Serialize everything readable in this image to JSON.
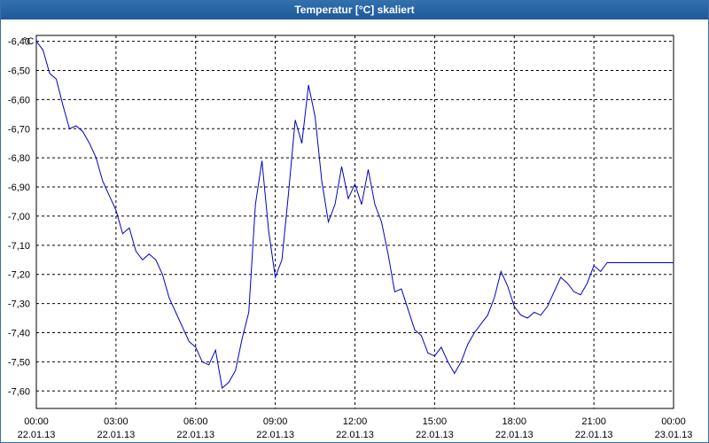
{
  "window": {
    "title": "Temperatur [°C] skaliert"
  },
  "colors": {
    "titlebar": "#1f5a99",
    "line": "#0000c8",
    "grid": "#000000",
    "background": "#ffffff"
  },
  "chart_data": {
    "type": "line",
    "title": "Temperatur [°C] skaliert",
    "ylabel": "°C",
    "xlabel": "",
    "grid": true,
    "ylim": [
      -7.66,
      -6.38
    ],
    "xlim": [
      0,
      24
    ],
    "y_ticks": [
      "-6,40",
      "-6,50",
      "-6,60",
      "-6,70",
      "-6,80",
      "-6,90",
      "-7,00",
      "-7,10",
      "-7,20",
      "-7,30",
      "-7,40",
      "-7,50",
      "-7,60"
    ],
    "x_ticks": [
      {
        "time": "00:00",
        "date": "22.01.13"
      },
      {
        "time": "03:00",
        "date": "22.01.13"
      },
      {
        "time": "06:00",
        "date": "22.01.13"
      },
      {
        "time": "09:00",
        "date": "22.01.13"
      },
      {
        "time": "12:00",
        "date": "22.01.13"
      },
      {
        "time": "15:00",
        "date": "22.01.13"
      },
      {
        "time": "18:00",
        "date": "22.01.13"
      },
      {
        "time": "21:00",
        "date": "22.01.13"
      },
      {
        "time": "00:00",
        "date": "23.01.13"
      }
    ],
    "series": [
      {
        "x": [
          0.0,
          0.25,
          0.5,
          0.75,
          1.0,
          1.25,
          1.5,
          1.75,
          2.0,
          2.25,
          2.5,
          2.75,
          3.0,
          3.25,
          3.5,
          3.75,
          4.0,
          4.25,
          4.5,
          4.75,
          5.0,
          5.25,
          5.5,
          5.75,
          6.0,
          6.25,
          6.5,
          6.75,
          7.0,
          7.25,
          7.5,
          7.75,
          8.0,
          8.25,
          8.5,
          8.75,
          9.0,
          9.25,
          9.5,
          9.75,
          10.0,
          10.25,
          10.5,
          10.75,
          11.0,
          11.25,
          11.5,
          11.75,
          12.0,
          12.25,
          12.5,
          12.75,
          13.0,
          13.25,
          13.5,
          13.75,
          14.0,
          14.25,
          14.5,
          14.75,
          15.0,
          15.25,
          15.5,
          15.75,
          16.0,
          16.25,
          16.5,
          16.75,
          17.0,
          17.25,
          17.5,
          17.75,
          18.0,
          18.25,
          18.5,
          18.75,
          19.0,
          19.25,
          19.5,
          19.75,
          20.0,
          20.25,
          20.5,
          20.75,
          21.0,
          21.25,
          21.5,
          21.75,
          22.0,
          22.25,
          22.5,
          22.75,
          23.0,
          23.25,
          23.5,
          23.75,
          24.0
        ],
        "y": [
          -6.4,
          -6.43,
          -6.51,
          -6.53,
          -6.62,
          -6.7,
          -6.69,
          -6.71,
          -6.75,
          -6.8,
          -6.88,
          -6.93,
          -6.98,
          -7.06,
          -7.04,
          -7.12,
          -7.15,
          -7.13,
          -7.15,
          -7.2,
          -7.28,
          -7.33,
          -7.38,
          -7.43,
          -7.45,
          -7.5,
          -7.51,
          -7.46,
          -7.59,
          -7.57,
          -7.53,
          -7.42,
          -7.33,
          -6.96,
          -6.81,
          -7.05,
          -7.21,
          -7.15,
          -6.92,
          -6.67,
          -6.75,
          -6.55,
          -6.66,
          -6.88,
          -7.02,
          -6.96,
          -6.83,
          -6.94,
          -6.89,
          -6.96,
          -6.84,
          -6.96,
          -7.02,
          -7.13,
          -7.26,
          -7.25,
          -7.32,
          -7.39,
          -7.41,
          -7.47,
          -7.48,
          -7.45,
          -7.5,
          -7.54,
          -7.5,
          -7.44,
          -7.4,
          -7.37,
          -7.34,
          -7.28,
          -7.19,
          -7.24,
          -7.31,
          -7.34,
          -7.35,
          -7.33,
          -7.34,
          -7.31,
          -7.26,
          -7.21,
          -7.23,
          -7.26,
          -7.27,
          -7.23,
          -7.17,
          -7.19,
          -7.16,
          -7.16,
          -7.16,
          -7.16,
          -7.16,
          -7.16,
          -7.16,
          -7.16,
          -7.16,
          -7.16,
          -7.16
        ]
      }
    ]
  }
}
